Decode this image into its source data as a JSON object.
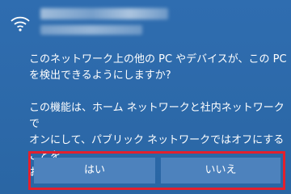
{
  "prompt": {
    "question": "このネットワーク上の他の PC やデバイスが、この PC\nを検出できるようにしますか?",
    "info": "この機能は、ホーム ネットワークと社内ネットワークで\nオンにして、パブリック ネットワークではオフにすることを\nお勧めします。"
  },
  "buttons": {
    "yes_label": "はい",
    "no_label": "いいえ"
  },
  "colors": {
    "background": "#2c69a8",
    "button": "#4d82bd",
    "highlight_border": "#e3202d",
    "text": "#ffffff"
  },
  "icons": {
    "network": "wifi-icon"
  }
}
